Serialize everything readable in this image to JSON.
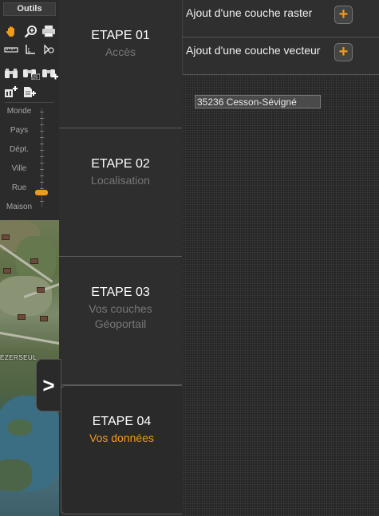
{
  "tools": {
    "title": "Outils",
    "icons": [
      "hand-pan-icon",
      "zoom-in-icon",
      "print-icon",
      "ruler-icon",
      "angle-measure-icon",
      "area-measure-icon",
      "binoculars-icon",
      "binoculars-scale-icon",
      "binoculars-plus-icon",
      "add-layer-icon",
      "add-document-icon"
    ],
    "zoom_levels": [
      "Monde",
      "Pays",
      "Dépt.",
      "Ville",
      "Rue",
      "Maison"
    ],
    "zoom_selected": "Rue",
    "accent": "#f29a1a"
  },
  "map": {
    "label": "ÉZERSEUL"
  },
  "toggle": {
    "label": ">"
  },
  "steps": [
    {
      "num": "ETAPE 01",
      "sub": "Accès"
    },
    {
      "num": "ETAPE 02",
      "sub": "Localisation"
    },
    {
      "num": "ETAPE 03",
      "sub": "Vos couches Géoportail"
    },
    {
      "num": "ETAPE 04",
      "sub": "Vos données"
    }
  ],
  "right": {
    "raster_label": "Ajout d'une couche raster",
    "vector_label": "Ajout d'une couche vecteur",
    "add_symbol": "+",
    "location_value": "35236 Cesson-Sévigné"
  }
}
